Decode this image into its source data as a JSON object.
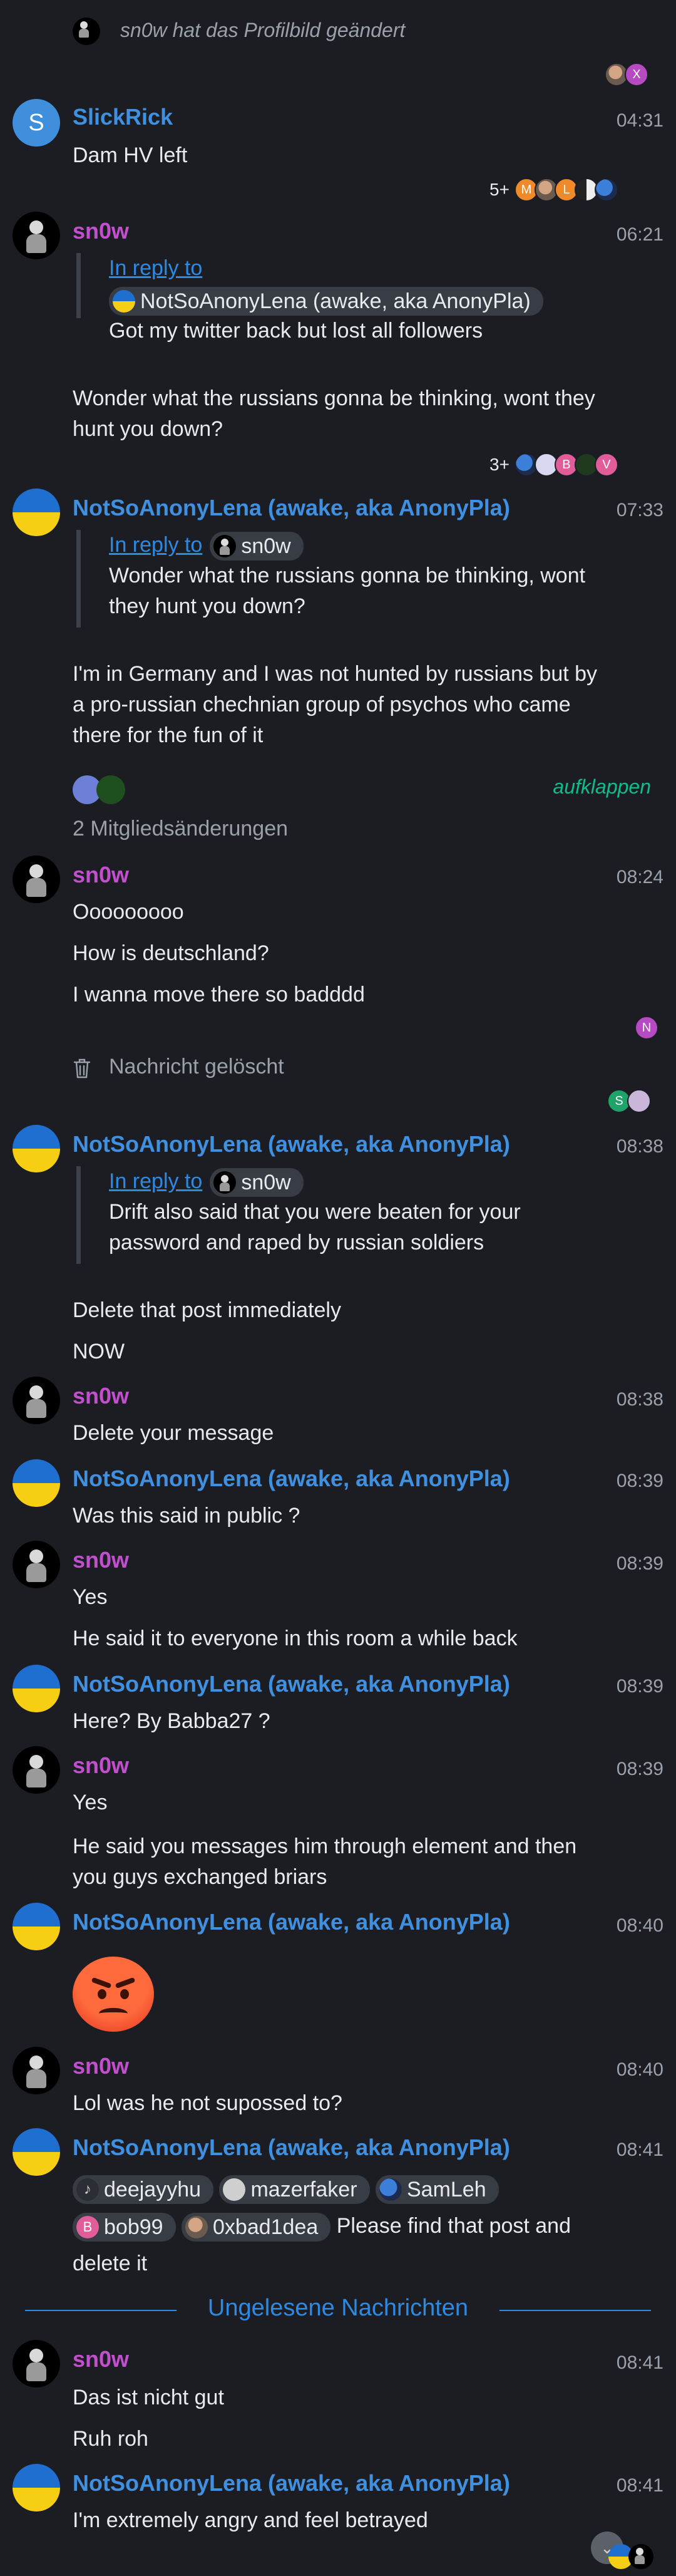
{
  "system": {
    "avatar_change": "sn0w hat das Profilbild geändert",
    "member_changes": "2 Mitgliedsänderungen",
    "expand": "aufklappen",
    "deleted": "Nachricht gelöscht",
    "unread_divider": "Ungelesene Nachrichten",
    "reply_label": "In reply to"
  },
  "read_receipts": {
    "r1": [
      "X"
    ],
    "r2": {
      "count": "5+",
      "letters": [
        "M",
        "L"
      ]
    },
    "r3": {
      "count": "3+",
      "letters": [
        "B",
        "V"
      ]
    },
    "r4": [
      "N"
    ],
    "r5": [
      "S"
    ]
  },
  "messages": {
    "m1": {
      "sender": "SlickRick",
      "avatar_letter": "S",
      "time": "04:31",
      "lines": [
        "Dam HV left"
      ]
    },
    "m2": {
      "sender": "sn0w",
      "time": "06:21",
      "reply_to": "NotSoAnonyLena (awake, aka AnonyPla)",
      "quote": "Got my twitter back but lost all followers",
      "text": "Wonder what the russians gonna be thinking, wont they hunt you down?"
    },
    "m3": {
      "sender": "NotSoAnonyLena (awake, aka AnonyPla)",
      "time": "07:33",
      "reply_to": "sn0w",
      "quote": "Wonder what the russians gonna be thinking, wont they hunt you down?",
      "text": "I'm in Germany and I was not hunted by russians but by a pro-russian chechnian group of psychos who came there for the fun of it"
    },
    "m4": {
      "sender": "sn0w",
      "time": "08:24",
      "lines": [
        "Ooooooooo",
        "How is deutschland?",
        "I wanna move there so badddd"
      ]
    },
    "m5": {
      "sender": "NotSoAnonyLena (awake, aka AnonyPla)",
      "time": "08:38",
      "reply_to": "sn0w",
      "quote": "Drift also said that you were beaten for your password and raped by russian soldiers",
      "lines": [
        "Delete that post immediately",
        "NOW"
      ]
    },
    "m6": {
      "sender": "sn0w",
      "time": "08:38",
      "lines": [
        "Delete your message"
      ]
    },
    "m7": {
      "sender": "NotSoAnonyLena (awake, aka AnonyPla)",
      "time": "08:39",
      "lines": [
        "Was this said in public ?"
      ]
    },
    "m8": {
      "sender": "sn0w",
      "time": "08:39",
      "lines": [
        "Yes",
        "He said it to everyone in this room a while back"
      ]
    },
    "m9": {
      "sender": "NotSoAnonyLena (awake, aka AnonyPla)",
      "time": "08:39",
      "lines": [
        "Here? By Babba27 ?"
      ]
    },
    "m10": {
      "sender": "sn0w",
      "time": "08:39",
      "lines": [
        "Yes",
        "He said you messages him through element and then you guys exchanged briars"
      ]
    },
    "m11": {
      "sender": "NotSoAnonyLena (awake, aka AnonyPla)",
      "time": "08:40",
      "emoji": "angry-face"
    },
    "m12": {
      "sender": "sn0w",
      "time": "08:40",
      "lines": [
        "Lol was he not supossed to?"
      ]
    },
    "m13": {
      "sender": "NotSoAnonyLena (awake, aka AnonyPla)",
      "time": "08:41",
      "mentions": [
        "deejayyhu",
        "mazerfaker",
        "SamLeh",
        "bob99",
        "0xbad1dea"
      ],
      "text": "Please find that post and delete it"
    },
    "m14": {
      "sender": "sn0w",
      "time": "08:41",
      "lines": [
        "Das ist nicht gut",
        "Ruh roh"
      ]
    },
    "m15": {
      "sender": "NotSoAnonyLena (awake, aka AnonyPla)",
      "time": "08:41",
      "lines": [
        "I'm extremely angry and feel betrayed"
      ]
    }
  },
  "colors": {
    "background": "#1b1d23",
    "sn0w": "#c24fce",
    "lena": "#3f90e0",
    "link": "#2d8ae3",
    "accent_green": "#0dbd8b"
  }
}
